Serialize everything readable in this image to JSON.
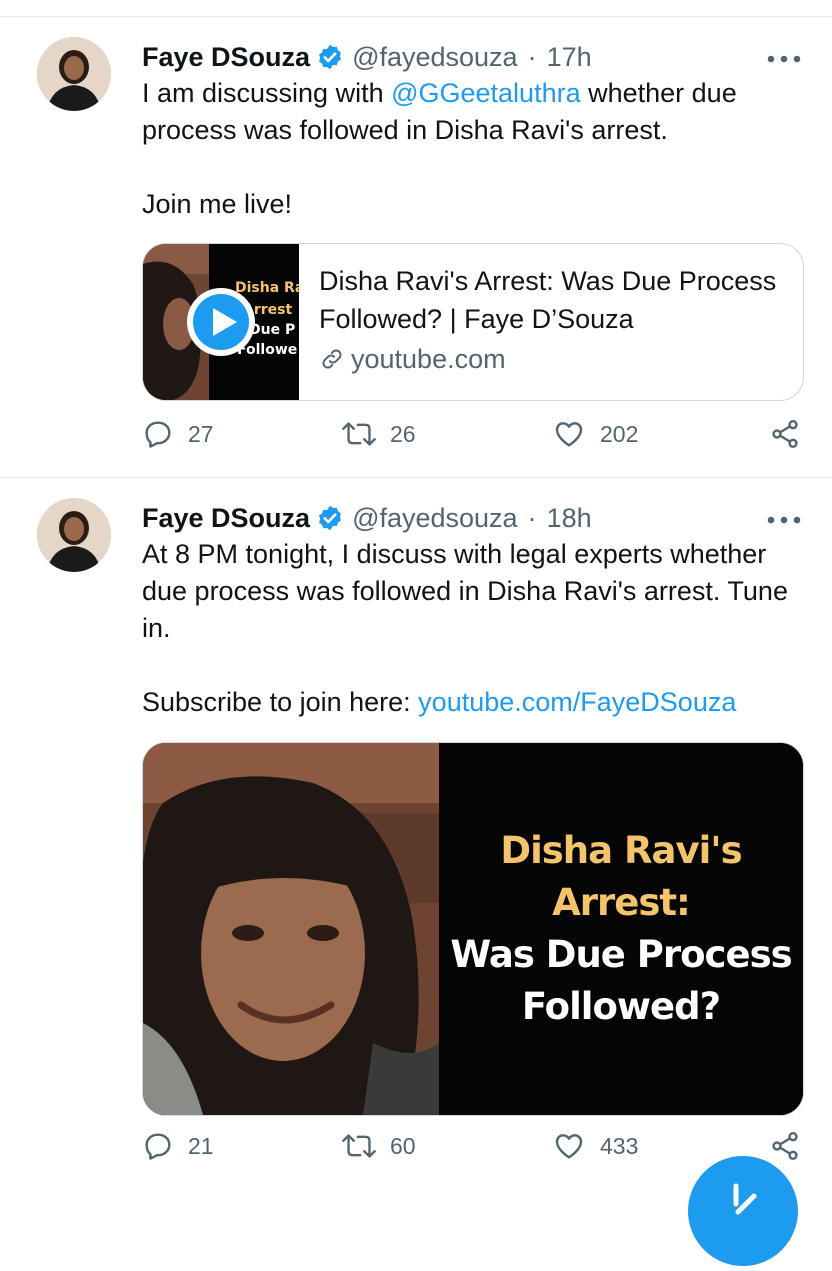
{
  "tweets": [
    {
      "name": "Faye DSouza",
      "handle": "@fayedsouza",
      "time": "17h",
      "text_pre": "I am discussing with ",
      "mention": "@GGeetaluthra",
      "text_post": " whether due process was followed in Disha Ravi's arrest.",
      "text_2": "Join me live!",
      "card": {
        "title": "Disha Ravi's Arrest: Was Due Process Followed? | Faye D’Souza",
        "domain": "youtube.com",
        "thumb_text": [
          "Disha Ra",
          "Arrest",
          "Due P",
          "Followe"
        ]
      },
      "replies": "27",
      "retweets": "26",
      "likes": "202"
    },
    {
      "name": "Faye DSouza",
      "handle": "@fayedsouza",
      "time": "18h",
      "text_1": "At 8 PM tonight, I discuss with legal experts whether due process was followed in Disha Ravi's arrest. Tune in.",
      "text_2_pre": "Subscribe to join here: ",
      "text_2_link": "youtube.com/FayeDSouza",
      "media": {
        "line1": "Disha Ravi's",
        "line2": "Arrest:",
        "line3": "Was Due Process",
        "line4": "Followed?"
      },
      "replies": "21",
      "retweets": "60",
      "likes": "433"
    }
  ],
  "icons": {
    "verified": "verified-badge-icon",
    "more": "more-dots-icon",
    "reply": "reply-icon",
    "retweet": "retweet-icon",
    "like": "heart-icon",
    "share": "share-icon",
    "play": "play-icon",
    "link": "link-icon"
  },
  "colors": {
    "accent": "#1d9bf0",
    "text": "#0f1419",
    "muted": "#536471",
    "thumb_yellow": "#f5c36b"
  }
}
